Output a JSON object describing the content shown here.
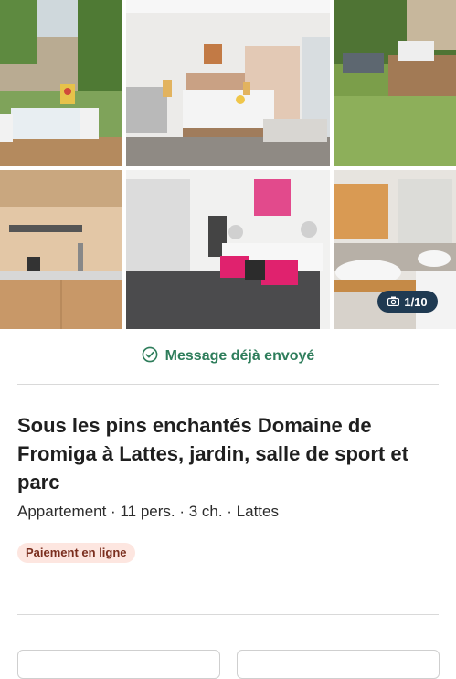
{
  "gallery": {
    "counter": "1/10",
    "photos": [
      "garden-terrace",
      "bedroom-1",
      "garden-lounger",
      "kitchen",
      "bedroom-2",
      "bathroom"
    ],
    "counter_icon": "camera-icon"
  },
  "status": {
    "message_sent": "Message déjà envoyé",
    "icon": "check-circle-icon",
    "color": "#2e7d5b"
  },
  "listing": {
    "title": "Sous les pins enchantés Domaine de Fromiga à Lattes, jardin, salle de sport et parc",
    "subtitle": "Appartement · 11 pers. · 3 ch. · Lattes",
    "badge": "Paiement en ligne"
  },
  "colors": {
    "badge_bg": "#fde6e0",
    "badge_text": "#7a2e1e",
    "counter_bg": "#1f3a52"
  }
}
